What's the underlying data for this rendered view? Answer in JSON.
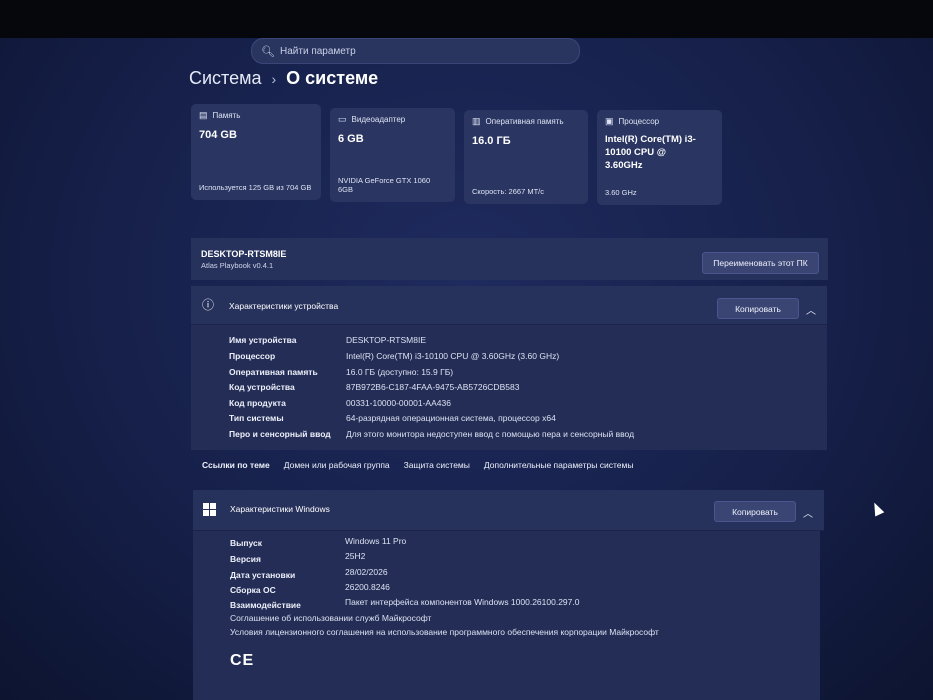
{
  "search": {
    "placeholder": "Найти параметр"
  },
  "breadcrumb": {
    "parent": "Система",
    "separator": "›",
    "current": "О системе"
  },
  "cards": [
    {
      "icon": "storage-icon",
      "title": "Память",
      "value": "704 GB",
      "sub": "Используется 125 GB из 704 GB"
    },
    {
      "icon": "gpu-icon",
      "title": "Видеоадаптер",
      "value": "6 GB",
      "sub": "NVIDIA GeForce GTX 1060 6GB"
    },
    {
      "icon": "ram-icon",
      "title": "Оперативная память",
      "value": "16.0 ГБ",
      "sub": "Скорость: 2667 МТ/с"
    },
    {
      "icon": "cpu-icon",
      "title": "Процессор",
      "value": "Intel(R) Core(TM) i3-10100 CPU @ 3.60GHz",
      "sub": "3.60 GHz"
    }
  ],
  "device": {
    "name": "DESKTOP-RTSM8IE",
    "sub": "Atlas Playbook v0.4.1",
    "rename_label": "Переименовать этот ПК"
  },
  "device_specs": {
    "title": "Характеристики устройства",
    "copy_label": "Копировать",
    "rows": [
      {
        "label": "Имя устройства",
        "value": "DESKTOP-RTSM8IE"
      },
      {
        "label": "Процессор",
        "value": "Intel(R) Core(TM) i3-10100 CPU @ 3.60GHz (3.60 GHz)"
      },
      {
        "label": "Оперативная память",
        "value": "16.0 ГБ (доступно: 15.9 ГБ)"
      },
      {
        "label": "Код устройства",
        "value": "87B972B6-C187-4FAA-9475-AB5726CDB583"
      },
      {
        "label": "Код продукта",
        "value": "00331-10000-00001-AA436"
      },
      {
        "label": "Тип системы",
        "value": "64-разрядная операционная система, процессор x64"
      },
      {
        "label": "Перо и сенсорный ввод",
        "value": "Для этого монитора недоступен ввод с помощью пера и сенсорный ввод"
      }
    ]
  },
  "related_links": [
    "Ссылки по теме",
    "Домен или рабочая группа",
    "Защита системы",
    "Дополнительные параметры системы"
  ],
  "windows_specs": {
    "title": "Характеристики Windows",
    "copy_label": "Копировать",
    "rows": [
      {
        "label": "Выпуск",
        "value": "Windows 11 Pro"
      },
      {
        "label": "Версия",
        "value": "25H2"
      },
      {
        "label": "Дата установки",
        "value": "28/02/2026"
      },
      {
        "label": "Сборка ОС",
        "value": "26200.8246"
      },
      {
        "label": "Взаимодействие",
        "value": "Пакет интерфейса компонентов Windows 1000.26100.297.0"
      }
    ],
    "agreements": [
      "Соглашение об использовании служб Майкрософт",
      "Условия лицензионного соглашения на использование программного обеспечения корпорации Майкрософт"
    ],
    "ce_mark": "CE"
  }
}
